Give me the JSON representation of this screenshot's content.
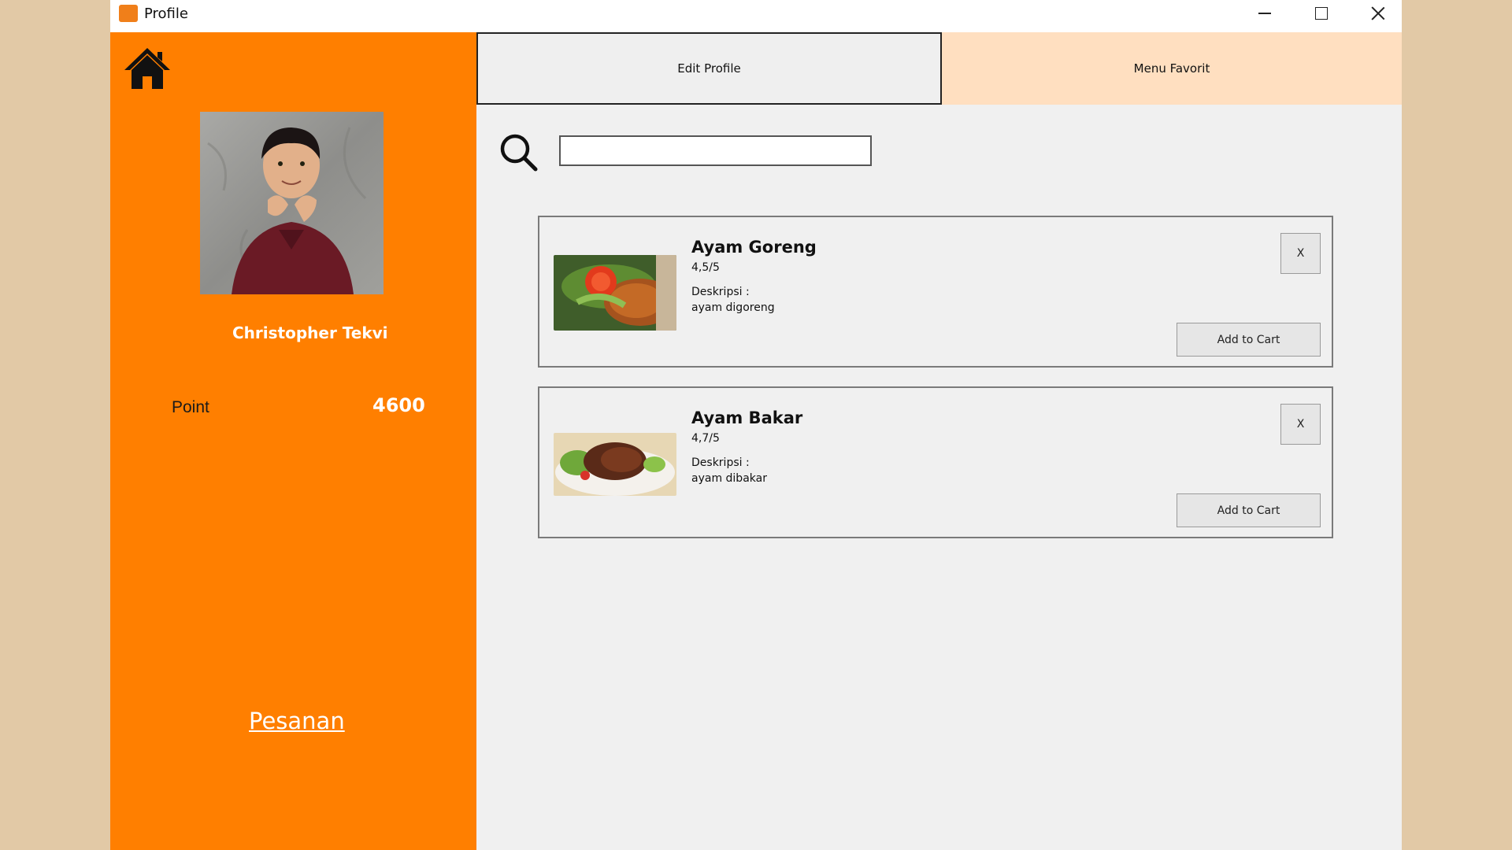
{
  "window": {
    "title": "Profile"
  },
  "sidebar": {
    "user_name": "Christopher Tekvi",
    "point_label": "Point",
    "point_value": "4600",
    "orders_link": "Pesanan"
  },
  "tabs": [
    {
      "label": "Edit Profile"
    },
    {
      "label": "Menu Favorit"
    }
  ],
  "search": {
    "value": "",
    "placeholder": ""
  },
  "favorites": [
    {
      "name": "Ayam Goreng",
      "rating": "4,5/5",
      "desc_label": "Deskripsi :",
      "desc": "ayam digoreng",
      "remove_label": "X",
      "cart_label": "Add to Cart"
    },
    {
      "name": "Ayam Bakar",
      "rating": "4,7/5",
      "desc_label": "Deskripsi :",
      "desc": "ayam dibakar",
      "remove_label": "X",
      "cart_label": "Add to Cart"
    }
  ],
  "colors": {
    "sidebar": "#ff7f00",
    "tab_active": "#efefef",
    "tab_inactive": "#ffdfc0",
    "content_bg": "#f0f0f0",
    "page_bg": "#e2c9a6"
  },
  "icons": [
    "home-icon",
    "search-icon",
    "minimize-icon",
    "maximize-icon",
    "close-icon"
  ]
}
